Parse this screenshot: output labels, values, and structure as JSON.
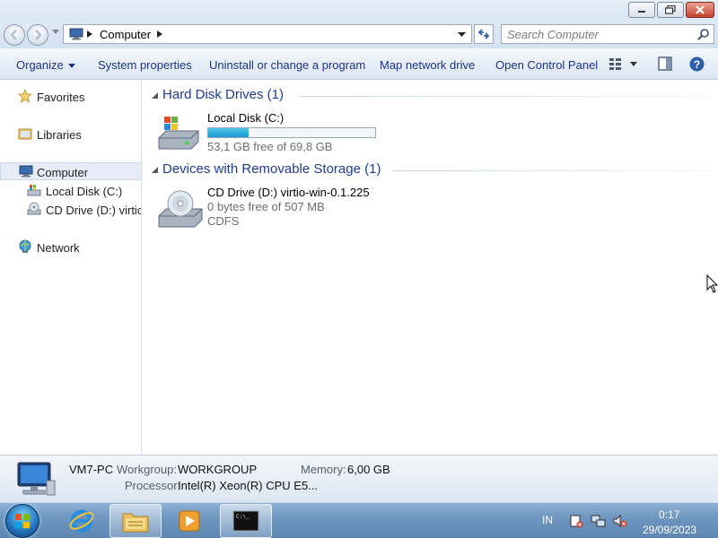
{
  "address": {
    "crumb": "Computer",
    "search_placeholder": "Search Computer"
  },
  "toolbar": {
    "organize": "Organize",
    "system_properties": "System properties",
    "uninstall": "Uninstall or change a program",
    "map_drive": "Map network drive",
    "control_panel": "Open Control Panel"
  },
  "navpane": {
    "favorites": "Favorites",
    "libraries": "Libraries",
    "computer": "Computer",
    "local_disk": "Local Disk (C:)",
    "cd_drive": "CD Drive (D:) virtio-w",
    "network": "Network"
  },
  "groups": {
    "hdd": {
      "title": "Hard Disk Drives (1)",
      "drive_name": "Local Disk (C:)",
      "free_text": "53,1 GB free of 69,8 GB",
      "used_fraction": 0.24
    },
    "removable": {
      "title": "Devices with Removable Storage (1)",
      "drive_name": "CD Drive (D:) virtio-win-0.1.225",
      "free_text": "0 bytes free of 507 MB",
      "fs": "CDFS"
    }
  },
  "details": {
    "pc_name": "VM7-PC",
    "workgroup_label": "Workgroup:",
    "workgroup_value": "WORKGROUP",
    "memory_label": "Memory:",
    "memory_value": "6,00 GB",
    "processor_label": "Processor:",
    "processor_value": "Intel(R) Xeon(R) CPU E5..."
  },
  "taskbar": {
    "lang": "IN",
    "time": "0:17",
    "date": "29/09/2023"
  },
  "colors": {
    "link_text": "#1e3287",
    "group_header": "#1e3c8c",
    "progress_fill": "#26a7da",
    "taskbar": "#6f97c0"
  }
}
